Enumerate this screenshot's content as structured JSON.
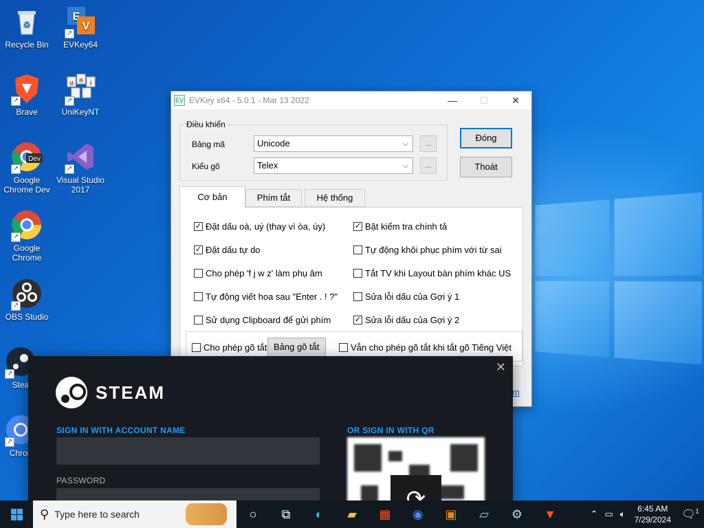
{
  "desktop": {
    "icons": [
      {
        "label": "Recycle Bin",
        "glyph": "🗑"
      },
      {
        "label": "EVKey64",
        "glyph": "EV"
      },
      {
        "label": "Brave",
        "glyph": "🦁"
      },
      {
        "label": "UniKeyNT",
        "glyph": "uni"
      },
      {
        "label": "Google Chrome Dev",
        "glyph": "Dev"
      },
      {
        "label": "Visual Studio 2017",
        "glyph": "VS"
      },
      {
        "label": "Google Chrome",
        "glyph": "●"
      },
      {
        "label": "OBS Studio",
        "glyph": "◉"
      },
      {
        "label": "Stea",
        "glyph": "⚙"
      },
      {
        "label": "Chron",
        "glyph": "●"
      }
    ]
  },
  "evkey": {
    "title": "EVKey x64 - 5.0.1 - Mar 13 2022",
    "minimize": "—",
    "maximize": "☐",
    "close": "✕",
    "group_label": "Điều khiển",
    "bang_ma_label": "Bảng mã",
    "bang_ma_value": "Unicode",
    "kieu_go_label": "Kiểu gõ",
    "kieu_go_value": "Telex",
    "dots": "...",
    "dong_button": "Đóng",
    "thoat_button": "Thoát",
    "tabs": [
      "Cơ bản",
      "Phím tắt",
      "Hệ thống"
    ],
    "options_left": [
      {
        "label": "Đặt dấu oà, uý (thay vì òa, úy)",
        "checked": true
      },
      {
        "label": "Đặt dấu tự do",
        "checked": true
      },
      {
        "label": "Cho phép 'f j w z' làm phụ âm",
        "checked": false
      },
      {
        "label": "Tự động viết hoa sau \"Enter . ! ?\"",
        "checked": false
      },
      {
        "label": "Sử dụng Clipboard để gửi phím",
        "checked": false
      }
    ],
    "options_right": [
      {
        "label": "Bật kiểm tra chính tả",
        "checked": true
      },
      {
        "label": "Tự động khôi phục phím với từ sai",
        "checked": false
      },
      {
        "label": "Tắt TV khi Layout bàn phím khác US",
        "checked": false
      },
      {
        "label": "Sửa lỗi dấu của Gợi ý 1",
        "checked": false
      },
      {
        "label": "Sửa lỗi dấu của Gợi ý 2",
        "checked": true
      }
    ],
    "shortcut_option": "Cho phép gõ tắt",
    "shortcut_table_button": "Bảng gõ tắt",
    "shortcut_when_off": "Vẫn cho phép gõ tắt khi tắt gõ Tiếng Việt",
    "partial_link": "m"
  },
  "steam": {
    "brand": "STEAM",
    "signin_label": "SIGN IN WITH ACCOUNT NAME",
    "password_label": "PASSWORD",
    "qr_label": "OR SIGN IN WITH QR",
    "close": "✕"
  },
  "taskbar": {
    "search_placeholder": "Type here to search",
    "time": "6:45 AM",
    "date": "7/29/2024",
    "notification_count": "1",
    "icons": [
      "cortana-icon",
      "task-view-icon",
      "edge-icon",
      "file-explorer-icon",
      "store-icon",
      "chrome-icon",
      "evkey-icon",
      "notepad-icon",
      "steam-icon",
      "brave-icon"
    ]
  }
}
